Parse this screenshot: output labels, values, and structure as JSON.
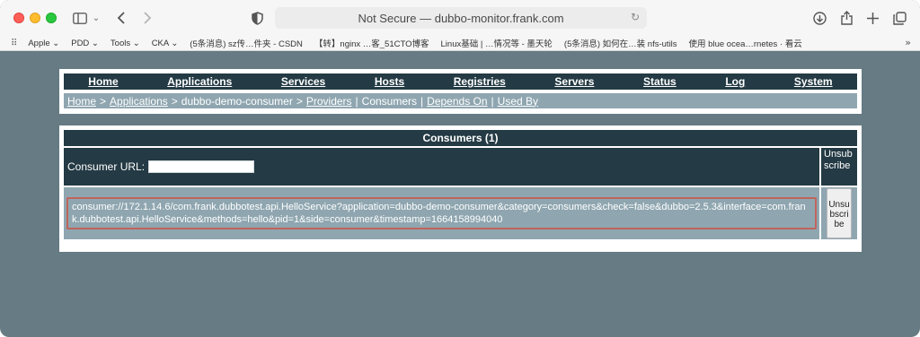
{
  "browser": {
    "address_text": "Not Secure — dubbo-monitor.frank.com",
    "bookmarks": [
      "Apple ⌄",
      "PDD ⌄",
      "Tools ⌄",
      "CKA ⌄",
      "(5条消息) sz传…件夹 - CSDN",
      "【转】nginx …客_51CTO博客",
      "Linux基础 | …情况等 - 墨天轮",
      "(5条消息) 如何在…装 nfs-utils",
      "使用 blue ocea…rnetes · 看云"
    ]
  },
  "menu": [
    "Home",
    "Applications",
    "Services",
    "Hosts",
    "Registries",
    "Servers",
    "Status",
    "Log",
    "System"
  ],
  "breadcrumb": {
    "home": "Home",
    "sep1": ">",
    "applications": "Applications",
    "sep2": ">",
    "app": "dubbo-demo-consumer",
    "sep3": ">",
    "providers": "Providers",
    "pipe1": "|",
    "consumers": "Consumers",
    "pipe2": "|",
    "depends_on": "Depends On",
    "pipe3": "|",
    "used_by": "Used By"
  },
  "table": {
    "caption": "Consumers (1)",
    "url_label": "Consumer URL:",
    "url_value": "",
    "unsubscribe_header": "Unsubscribe",
    "rows": [
      {
        "url": "consumer://172.1.14.6/com.frank.dubbotest.api.HelloService?application=dubbo-demo-consumer&category=consumers&check=false&dubbo=2.5.3&interface=com.frank.dubbotest.api.HelloService&methods=hello&pid=1&side=consumer&timestamp=1664158994040",
        "action": "Unsubscribe"
      }
    ]
  }
}
